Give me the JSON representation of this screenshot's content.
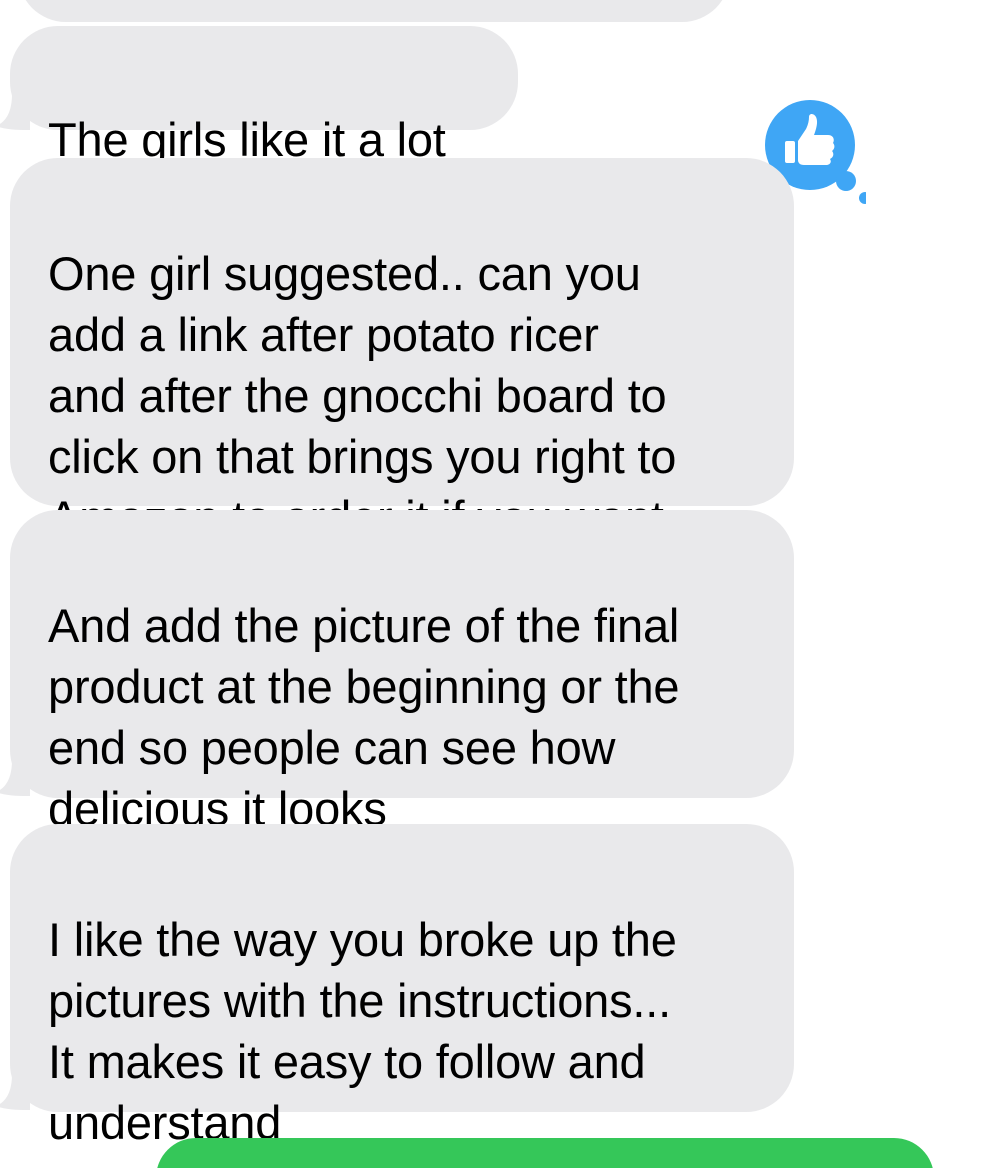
{
  "conversation": {
    "messages": [
      {
        "text": "The girls like it a lot"
      },
      {
        "text": "One girl suggested.. can you\nadd a link after potato ricer\nand after the gnocchi board to\nclick on that brings you right to\nAmazon to order it if you want"
      },
      {
        "text": "And add the picture of the final\nproduct at the beginning or the\nend so people can see how\ndelicious it looks"
      },
      {
        "text": "I like the way you broke up the\npictures with the instructions...\nIt makes it easy to follow and\nunderstand"
      }
    ],
    "reaction": {
      "icon": "thumbs-up-icon",
      "color": "#3fa6f5"
    },
    "colors": {
      "received_bubble": "#e9e9eb",
      "sent_bubble": "#35c759"
    }
  }
}
